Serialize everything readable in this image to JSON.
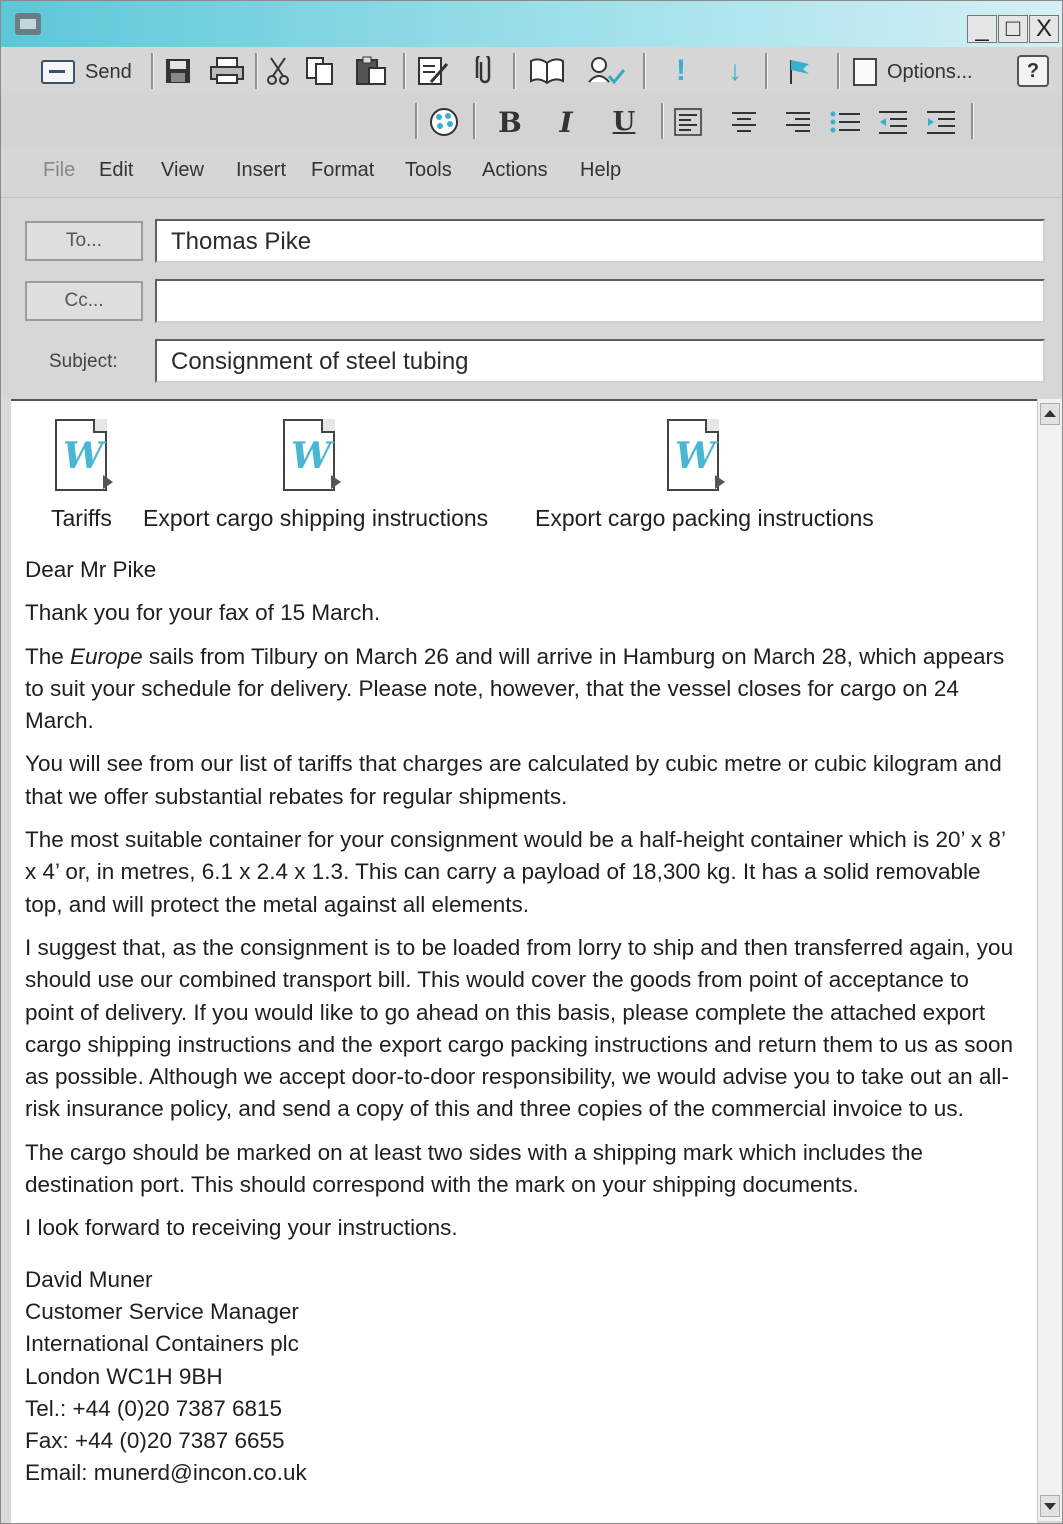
{
  "window": {
    "minimize": "_",
    "maximize": "□",
    "close": "X"
  },
  "toolbar": {
    "send_label": "Send",
    "options_label": "Options...",
    "help_label": "?"
  },
  "format": {
    "font": "Arial",
    "size": "10",
    "bold": "B",
    "italic": "I",
    "underline": "U"
  },
  "menu": [
    "File",
    "Edit",
    "View",
    "Insert",
    "Format",
    "Tools",
    "Actions",
    "Help"
  ],
  "header": {
    "to_button": "To...",
    "cc_button": "Cc...",
    "subject_label": "Subject:",
    "to_value": "Thomas Pike",
    "cc_value": "",
    "subject_value": "Consignment of steel tubing"
  },
  "attachments": [
    {
      "label": "Tariffs"
    },
    {
      "label": "Export cargo shipping instructions"
    },
    {
      "label": "Export cargo packing instructions"
    }
  ],
  "message": {
    "greeting": "Dear Mr Pike",
    "p1": "Thank you for your fax of 15 March.",
    "p2_before": "The ",
    "p2_ship": "Europe",
    "p2_after": " sails from Tilbury on March 26 and will arrive in Hamburg on March 28, which appears to suit your schedule for delivery. Please note, however, that the vessel closes for cargo on 24 March.",
    "p3": "You will see from our list of tariffs that charges are calculated by cubic metre or cubic kilogram and that we offer substantial rebates for regular shipments.",
    "p4": "The most suitable container for your consignment would be a half-height container which is 20’ x 8’ x 4’ or, in metres, 6.1 x 2.4 x 1.3. This can carry a payload of 18,300 kg. It has a solid removable top, and will protect the metal against all elements.",
    "p5": "I suggest that, as the consignment is to be loaded from lorry to ship and then transferred again, you should use our combined transport bill. This would cover the goods from point of acceptance to point of delivery. If you would like to go ahead on this basis, please complete the attached export cargo shipping instructions and the export cargo packing instructions and return them to us as soon as possible. Although we accept door-to-door responsibility, we would advise you to take out an all-risk insurance policy, and send a copy of this and three copies of the commercial invoice to us.",
    "p6": "The cargo should be marked on at least two sides with a shipping mark which includes the destination port. This should correspond with the mark on your shipping documents.",
    "p7": "I look forward to receiving your instructions.",
    "signature": [
      "David Muner",
      "Customer Service Manager",
      "International Containers plc",
      "London WC1H 9BH",
      "Tel.: +44 (0)20 7387 6815",
      "Fax: +44 (0)20 7387 6655",
      "Email: munerd@incon.co.uk"
    ]
  }
}
